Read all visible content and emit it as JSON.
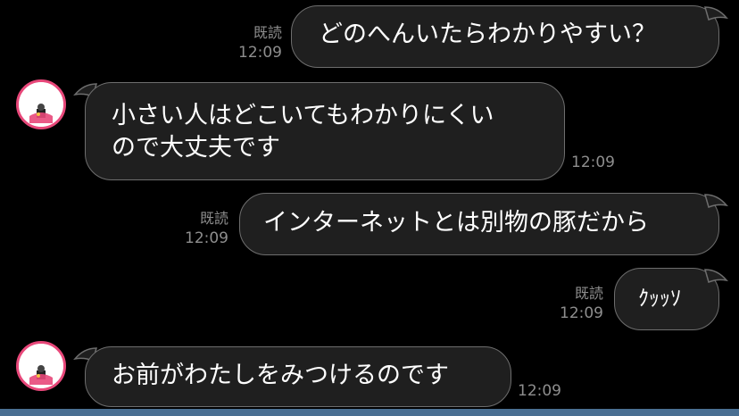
{
  "messages": [
    {
      "id": "m1",
      "direction": "outgoing",
      "text_lines": [
        "どのへんいたらわかりやすい？"
      ],
      "read_label": "既読",
      "time": "12:09"
    },
    {
      "id": "m2",
      "direction": "incoming",
      "text_lines": [
        "小さい人はどこいてもわかりにくい",
        "ので大丈夫です"
      ],
      "time": "12:09"
    },
    {
      "id": "m3",
      "direction": "outgoing",
      "text_lines": [
        "インターネットとは別物の豚だから"
      ],
      "read_label": "既読",
      "time": "12:09"
    },
    {
      "id": "m4",
      "direction": "outgoing",
      "text_lines": [
        "ｸｯｯｿ"
      ],
      "read_label": "既読",
      "time": "12:09"
    },
    {
      "id": "m5",
      "direction": "incoming",
      "text_lines": [
        "お前がわたしをみつけるのです"
      ],
      "time": "12:09"
    }
  ],
  "colors": {
    "background": "#000000",
    "bubble_fill": "#1f1f1f",
    "bubble_border": "#6e6e6e",
    "meta_text": "#8e8e8e",
    "avatar_ring": "#e8487a",
    "bottom_bar": "#4a6f92"
  },
  "icons": {
    "avatar": "character-avatar-icon"
  }
}
